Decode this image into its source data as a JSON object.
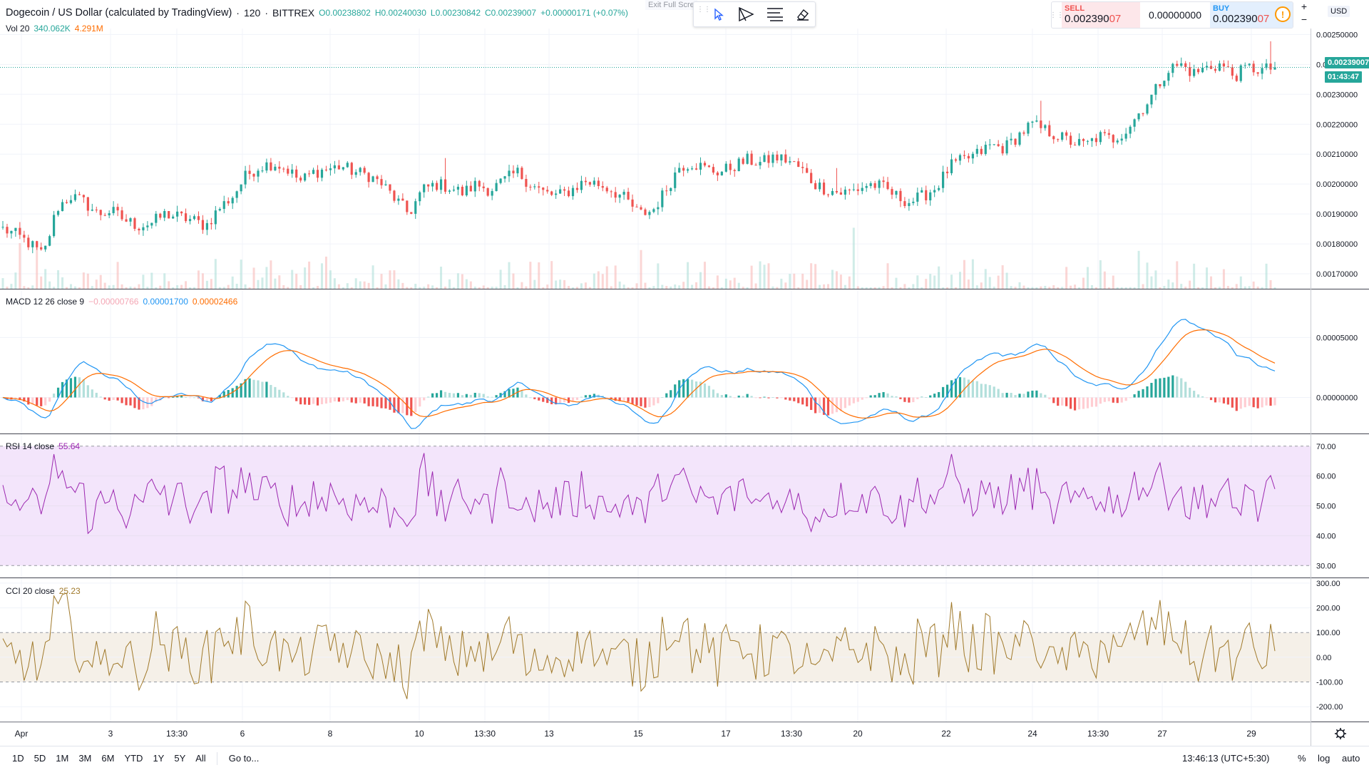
{
  "header": {
    "symbol_title": "Dogecoin / US Dollar (calculated by TradingView)",
    "interval": "120",
    "exchange": "BITTREX",
    "ohlc": {
      "open": "O0.00238802",
      "high": "H0.00240030",
      "low": "L0.00230842",
      "close": "C0.00239007",
      "change": "+0.00000171 (+0.07%)"
    },
    "volume": {
      "label": "Vol 20",
      "value1": "340.062K",
      "value2": "4.291M"
    },
    "exit_fullscreen": "Exit Full Scre"
  },
  "toolbar": {
    "icons": [
      "cursor-icon",
      "trend-line-icon",
      "text-lines-icon",
      "eraser-icon"
    ]
  },
  "trade": {
    "sell_label": "SELL",
    "sell_price_main": "0.002390",
    "sell_price_hl": "07",
    "spread": "0.00000000",
    "buy_label": "BUY",
    "buy_price_main": "0.002390",
    "buy_price_hl": "07",
    "info_icon": "!",
    "plus": "+",
    "minus": "−",
    "currency": "USD"
  },
  "price_axis": {
    "main_ticks": [
      "0.00250000",
      "0.00240000",
      "0.00230000",
      "0.00220000",
      "0.00210000",
      "0.00200000",
      "0.00190000",
      "0.00180000",
      "0.00170000"
    ],
    "last_price": "0.00239007",
    "countdown": "01:43:47",
    "macd_ticks": [
      "0.00005000",
      "0.00000000"
    ],
    "rsi_ticks": [
      "70.00",
      "60.00",
      "50.00",
      "40.00",
      "30.00"
    ],
    "cci_ticks": [
      "300.00",
      "200.00",
      "100.00",
      "0.00",
      "-100.00",
      "-200.00"
    ]
  },
  "indicators": {
    "macd": {
      "label": "MACD 12 26 close 9",
      "hist": "−0.00000766",
      "macd": "0.00001700",
      "signal": "0.00002466"
    },
    "rsi": {
      "label": "RSI 14 close",
      "value": "55.64"
    },
    "cci": {
      "label": "CCI 20 close",
      "value": "25.23"
    }
  },
  "time_axis": {
    "labels": [
      "Apr",
      "3",
      "13:30",
      "6",
      "8",
      "10",
      "13:30",
      "13",
      "15",
      "17",
      "13:30",
      "20",
      "22",
      "24",
      "13:30",
      "27",
      "29"
    ]
  },
  "bottom_bar": {
    "timeframes": [
      "1D",
      "5D",
      "1M",
      "3M",
      "6M",
      "YTD",
      "1Y",
      "5Y",
      "All"
    ],
    "goto": "Go to...",
    "clock": "13:46:13 (UTC+5:30)",
    "percent": "%",
    "log": "log",
    "auto": "auto"
  },
  "colors": {
    "up": "#26a69a",
    "down": "#ef5350",
    "macd_line": "#2196f3",
    "signal_line": "#ff6d00",
    "rsi_line": "#9c27b0",
    "rsi_band": "#f3e5fb",
    "cci_line": "#a0792a",
    "cci_band": "#f5f0e8"
  },
  "chart_data": [
    {
      "type": "candlestick",
      "title": "Dogecoin / US Dollar (calculated by TradingView) · 120 · BITTREX",
      "ylim": [
        0.00165,
        0.00252
      ],
      "close_series": [
        0.00185,
        0.00183,
        0.0018,
        0.00176,
        0.00192,
        0.00196,
        0.00194,
        0.0019,
        0.00191,
        0.00188,
        0.00186,
        0.00187,
        0.0019,
        0.00189,
        0.00188,
        0.00186,
        0.00192,
        0.00196,
        0.00203,
        0.00206,
        0.00207,
        0.00205,
        0.00201,
        0.00204,
        0.00205,
        0.00206,
        0.00204,
        0.00203,
        0.002,
        0.00195,
        0.0019,
        0.00198,
        0.002,
        0.00199,
        0.00197,
        0.002,
        0.00198,
        0.00201,
        0.00204,
        0.002,
        0.00197,
        0.00196,
        0.00198,
        0.00201,
        0.002,
        0.00198,
        0.00195,
        0.0019,
        0.00191,
        0.00198,
        0.00206,
        0.00207,
        0.00205,
        0.00204,
        0.00206,
        0.00208,
        0.00207,
        0.00209,
        0.00208,
        0.00205,
        0.002,
        0.00198,
        0.00197,
        0.00198,
        0.002,
        0.00199,
        0.00196,
        0.00194,
        0.00196,
        0.00199,
        0.00206,
        0.00208,
        0.0021,
        0.00213,
        0.00212,
        0.00216,
        0.0022,
        0.00218,
        0.00216,
        0.00214,
        0.00213,
        0.00216,
        0.00215,
        0.00218,
        0.00224,
        0.0023,
        0.00238,
        0.0024,
        0.00237,
        0.00239,
        0.0024,
        0.00236,
        0.00239,
        0.00238,
        0.00239
      ],
      "last": 0.00239007
    },
    {
      "type": "line",
      "title": "MACD 12 26 close 9",
      "series": [
        {
          "name": "MACD",
          "last": 1.7e-05
        },
        {
          "name": "Signal",
          "last": 2.466e-05
        }
      ],
      "ylim": [
        -3e-05,
        9e-05
      ]
    },
    {
      "type": "line",
      "title": "RSI 14 close",
      "series": [
        {
          "name": "RSI",
          "last": 55.64
        }
      ],
      "ylim": [
        26,
        74
      ],
      "band": [
        30,
        70
      ]
    },
    {
      "type": "line",
      "title": "CCI 20 close",
      "series": [
        {
          "name": "CCI",
          "last": 25.23
        }
      ],
      "ylim": [
        -260,
        320
      ],
      "band": [
        -100,
        100
      ]
    }
  ]
}
